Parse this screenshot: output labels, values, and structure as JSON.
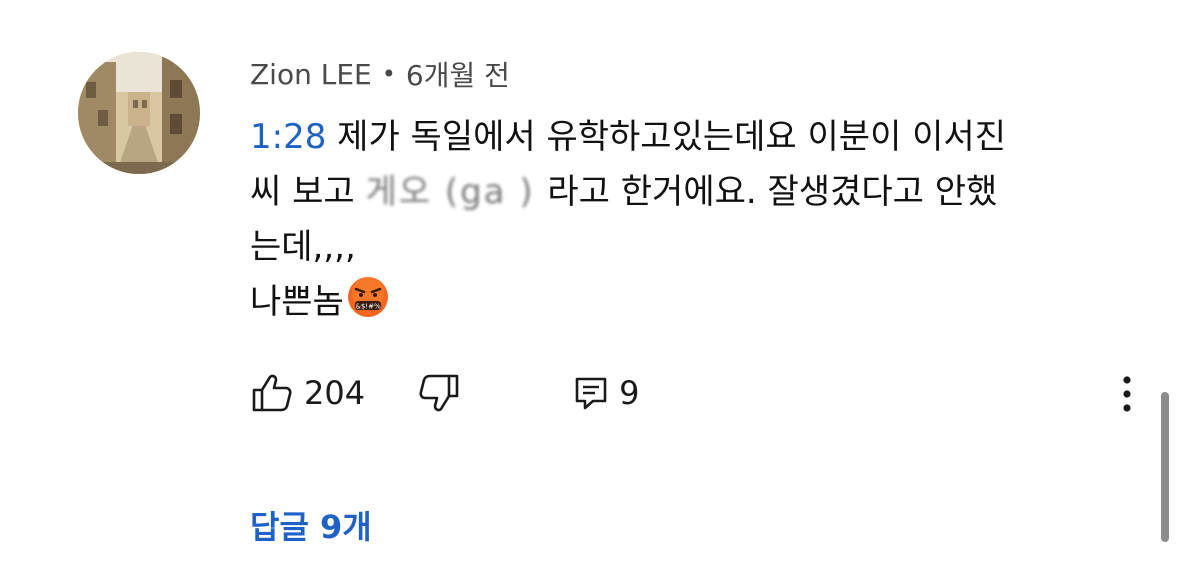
{
  "comment": {
    "author": "Zion LEE",
    "separator": "•",
    "time_ago": "6개월 전",
    "timestamp_link": "1:28",
    "line1_text": " 제가 독일에서 유학하고있는데요 이분이 이서진",
    "line2_pre": "씨 보고 ",
    "line2_blur1": "게오",
    "line2_blur2": " (ga ) ",
    "line2_post": "라고 한거에요. 잘생겼다고 안했",
    "line3": "는데,,,,",
    "line4": "나쁜놈",
    "emoji_icon": "angry-cursing-face-icon",
    "likes": "204",
    "replies_count": "9",
    "replies_link": "답글 9개"
  },
  "colors": {
    "link": "#1f62c7",
    "text": "#111111",
    "meta": "#4a4a4a",
    "emoji_face": "#f4651f"
  }
}
